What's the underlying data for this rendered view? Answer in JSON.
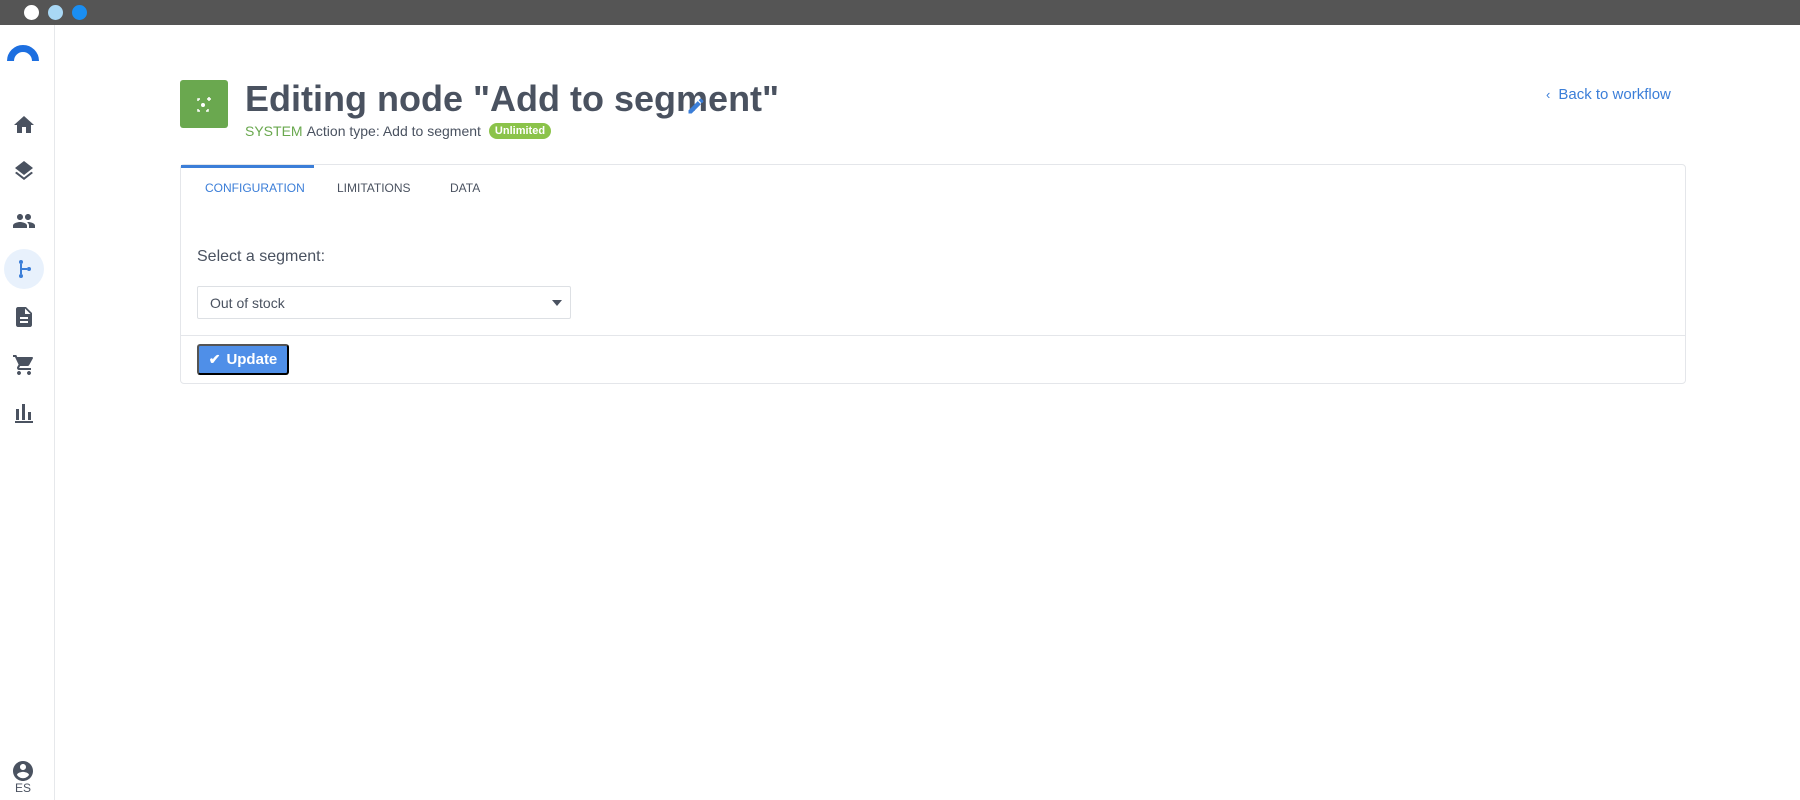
{
  "window": {
    "controls": [
      "close",
      "minimize",
      "maximize"
    ]
  },
  "sidebar": {
    "logo_icon": "brand-arc-icon",
    "items": [
      {
        "icon": "home-icon",
        "active": false
      },
      {
        "icon": "layers-icon",
        "active": false
      },
      {
        "icon": "people-icon",
        "active": false
      },
      {
        "icon": "workflow-branch-icon",
        "active": true
      },
      {
        "icon": "document-icon",
        "active": false
      },
      {
        "icon": "cart-icon",
        "active": false
      },
      {
        "icon": "bar-chart-icon",
        "active": false
      }
    ],
    "user_icon": "account-circle-icon",
    "language": "ES"
  },
  "header": {
    "node_icon": "segment-node-icon",
    "title": "Editing node \"Add to segment\"",
    "edit_icon": "pencil-icon",
    "system_label": "SYSTEM",
    "action_type": "Action type: Add to segment",
    "badge": "Unlimited",
    "back_link": "Back to workflow"
  },
  "tabs": [
    {
      "label": "CONFIGURATION",
      "active": true
    },
    {
      "label": "LIMITATIONS",
      "active": false
    },
    {
      "label": "DATA",
      "active": false
    }
  ],
  "form": {
    "segment_label": "Select a segment:",
    "segment_value": "Out of stock"
  },
  "actions": {
    "update_label": "Update"
  },
  "colors": {
    "accent": "#3b7ed8",
    "brand_green": "#6aa84f",
    "badge_green": "#8bc34a",
    "button_blue": "#4f8fe8"
  }
}
